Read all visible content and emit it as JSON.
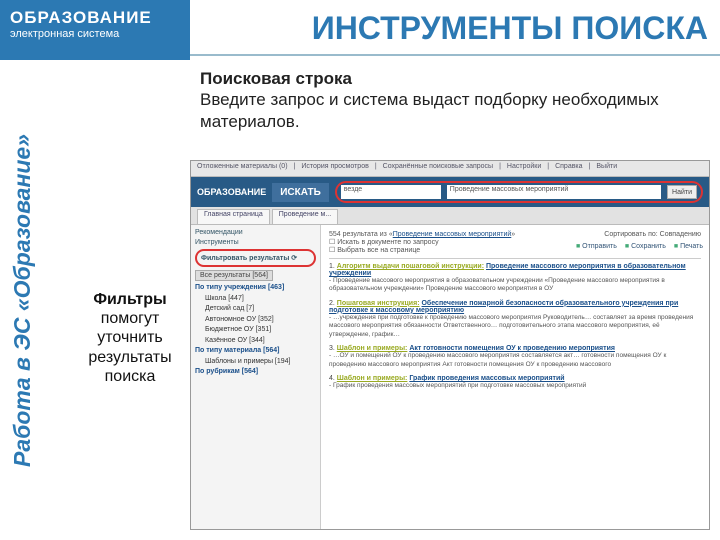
{
  "logo": {
    "l1": "ОБРАЗОВАНИЕ",
    "l2": "электронная система"
  },
  "title": "ИНСТРУМЕНТЫ ПОИСКА",
  "sideLabel": "Работа в ЭС «Образование»",
  "desc": {
    "head": "Поисковая строка",
    "body": "Введите запрос и  система выдаст подборку необходимых материалов."
  },
  "callout": {
    "head": "Фильтры",
    "body": "помогут уточнить результаты поиска"
  },
  "sc": {
    "topmenu": [
      "Отложенные материалы (0)",
      "История просмотров",
      "Сохранённые поисковые запросы",
      "Настройки",
      "Справка",
      "Выйти"
    ],
    "brand": "ОБРАЗОВАНИЕ",
    "searchLabel": "ИСКАТЬ",
    "field1": "везде",
    "field2": "Проведение массовых мероприятий",
    "go": "Найти",
    "tabs": [
      "Главная страница",
      "Проведение м..."
    ],
    "sideBlocks": [
      "Рекомендации",
      "Инструменты"
    ],
    "filterLabel": "Фильтровать результаты  ⟳",
    "allTab": "Все результаты [564]",
    "tree": [
      {
        "l": "По типу учреждения [463]",
        "c": [
          "Школа [447]",
          "Детский сад [7]",
          "Автономное ОУ [352]",
          "Бюджетное ОУ [351]",
          "Казённое ОУ [344]"
        ]
      },
      {
        "l": "По типу материала [564]",
        "c": [
          "Шаблоны и примеры [194]"
        ]
      },
      {
        "l": "По рубрикам [564]",
        "c": []
      }
    ],
    "toolbar": [
      "Отправить",
      "Сохранить",
      "Печать"
    ],
    "summary": {
      "count": "554 результата из",
      "link": "Проведение массовых мероприятий",
      "right": "Сортировать по: Совпадению",
      "chk1": "Искать в документе по запросу",
      "chk2": "Выбрать все на странице"
    },
    "results": [
      {
        "n": "1.",
        "pre": "Алгоритм выдачи пошаговой инструкции:",
        "t": "Проведение массового мероприятия в образовательном учреждении",
        "d": "- Проведение массового мероприятия в образовательном учреждении «Проведение массового мероприятия в образовательном учреждении» Проведение массового мероприятия в ОУ"
      },
      {
        "n": "2.",
        "pre": "Пошаговая инструкция:",
        "t": "Обеспечение пожарной безопасности образовательного учреждения при подготовке к массовому мероприятию",
        "d": "- …учреждения при подготовке к проведению массового мероприятия Руководитель… составляет за время проведения массового мероприятия обязанности Ответственного… подготовительного этапа массового мероприятия, её утверждение, график…"
      },
      {
        "n": "3.",
        "pre": "Шаблон и примеры:",
        "t": "Акт готовности помещения ОУ к проведению мероприятия",
        "d": "- …ОУ и помещений ОУ к проведению массового мероприятия составляется акт… готовности помещения ОУ к проведению массового мероприятия Акт готовности помещения ОУ к проведению массового"
      },
      {
        "n": "4.",
        "pre": "Шаблон и примеры:",
        "t": "График проведения массовых мероприятий",
        "d": "- График проведения массовых мероприятий при подготовке массовых мероприятий"
      }
    ]
  }
}
